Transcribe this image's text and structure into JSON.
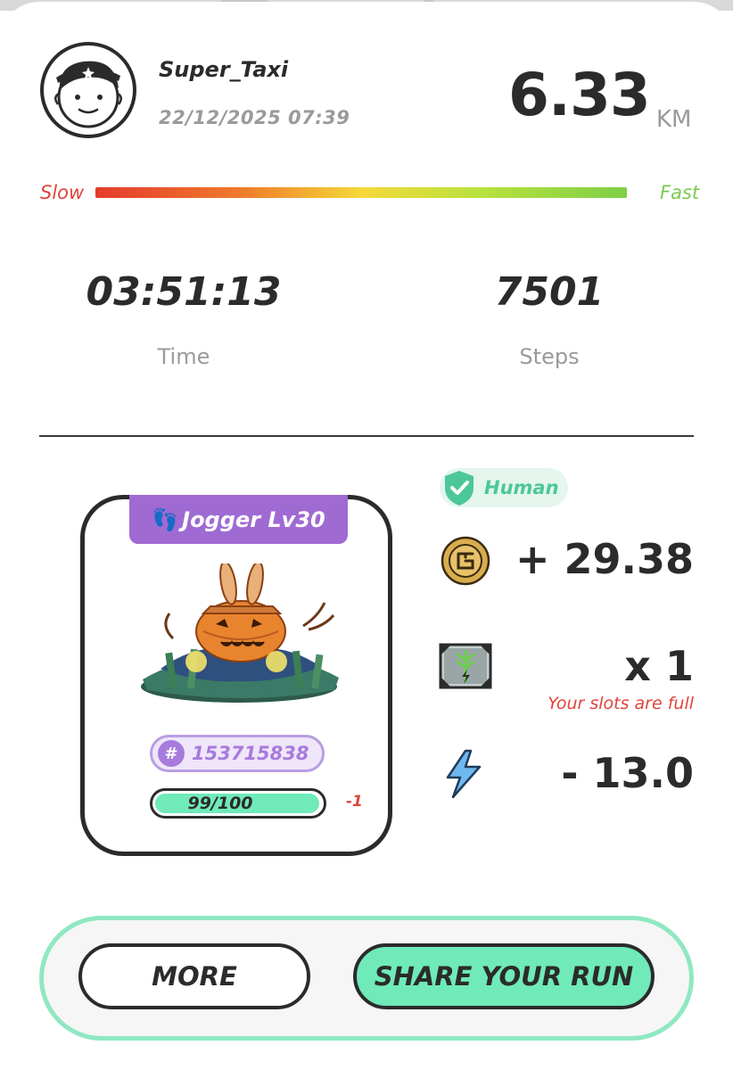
{
  "header": {
    "username": "Super_Taxi",
    "datetime": "22/12/2025 07:39",
    "distance": "6.33",
    "distance_unit": "KM"
  },
  "speed": {
    "slow_label": "Slow",
    "fast_label": "Fast"
  },
  "stats": {
    "time_value": "03:51:13",
    "time_label": "Time",
    "steps_value": "7501",
    "steps_label": "Steps"
  },
  "sneaker": {
    "type_label": "Jogger Lv30",
    "id_hash": "#",
    "id": "153715838",
    "durability": "99/100",
    "durability_fraction": 0.99,
    "durability_delta": "-1"
  },
  "rewards": {
    "human_badge": "Human",
    "gst": "+ 29.38",
    "mystery_box": "x 1",
    "slots_warning": "Your slots are full",
    "energy": "- 13.0"
  },
  "actions": {
    "more_label": "MORE",
    "share_label": "SHARE YOUR RUN"
  },
  "colors": {
    "accent_mint": "#6feab8",
    "purple": "#9f6ad2",
    "warning_red": "#e0443a",
    "fast_green": "#7cc94e"
  },
  "icons": {
    "avatar": "cartoon-avatar-icon",
    "feet": "footprints-icon",
    "shield": "shield-check-icon",
    "coin": "gst-coin-icon",
    "box": "mystery-box-icon",
    "energy": "lightning-icon"
  }
}
